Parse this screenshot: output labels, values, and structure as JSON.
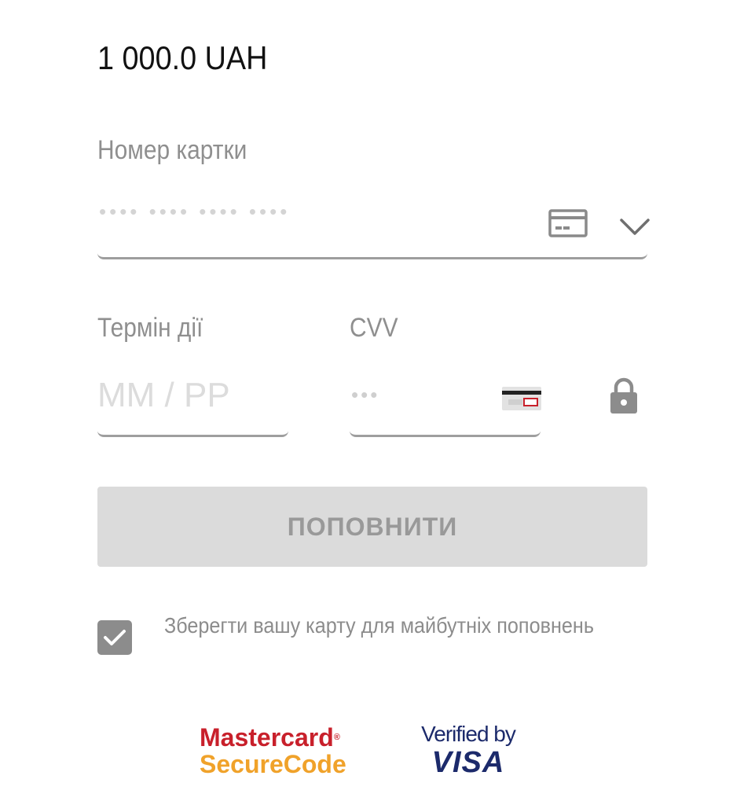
{
  "payment": {
    "amount": "1 000.0 UAH"
  },
  "card_number": {
    "label": "Номер картки",
    "placeholder": "•••• •••• •••• ••••",
    "value": ""
  },
  "expiry": {
    "label": "Термін дії",
    "placeholder": "MM / PP",
    "value": ""
  },
  "cvv": {
    "label": "CVV",
    "placeholder": "•••",
    "value": ""
  },
  "submit": {
    "label": "ПОПОВНИТИ",
    "enabled": false
  },
  "save_card": {
    "checked": true,
    "label": "Зберегти вашу карту для майбутніх поповнень"
  },
  "logos": {
    "mastercard_line1": "Mastercard",
    "mastercard_line2": "SecureCode",
    "visa_line1": "Verified by",
    "visa_line2": "VISA"
  },
  "icons": {
    "card_icon": "credit-card-icon",
    "dropdown_icon": "chevron-down-icon",
    "cvv_icon": "card-cvv-icon",
    "lock_icon": "lock-icon",
    "check_icon": "checkmark-icon"
  },
  "colors": {
    "text_primary": "#111111",
    "label_gray": "#8f8f8f",
    "button_disabled_bg": "#dbdbdb",
    "button_disabled_text": "#999999",
    "checkbox_bg": "#8c8c8c",
    "mastercard_red": "#c8202b",
    "mastercard_orange": "#f0a22a",
    "visa_blue": "#1c2a6b"
  }
}
